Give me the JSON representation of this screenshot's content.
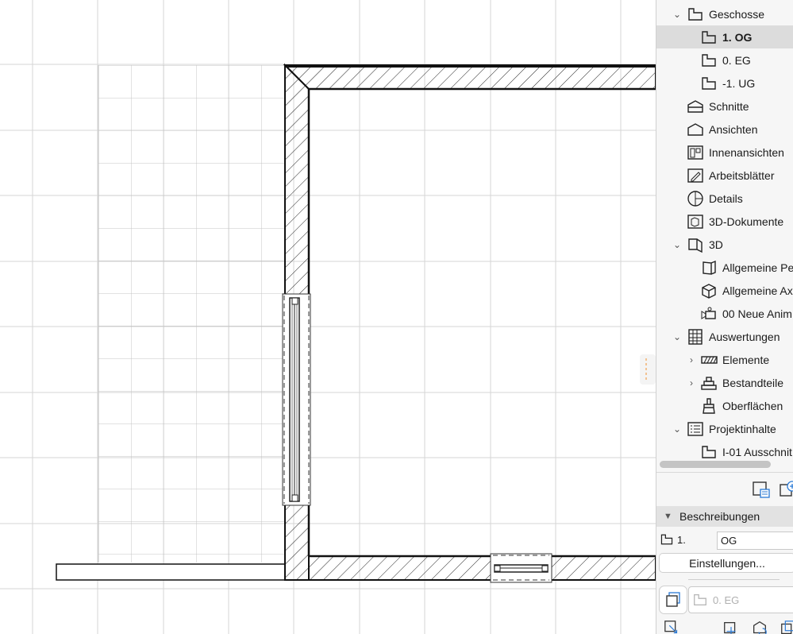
{
  "navigator": {
    "items": [
      {
        "label": "Geschosse",
        "icon": "floor-icon"
      },
      {
        "label": "1. OG",
        "icon": "floor-icon",
        "selected": true
      },
      {
        "label": "0. EG",
        "icon": "floor-icon"
      },
      {
        "label": "-1. UG",
        "icon": "floor-icon"
      },
      {
        "label": "Schnitte",
        "icon": "section-icon"
      },
      {
        "label": "Ansichten",
        "icon": "elevation-icon"
      },
      {
        "label": "Innenansichten",
        "icon": "interior-elevation-icon"
      },
      {
        "label": "Arbeitsblätter",
        "icon": "worksheet-icon"
      },
      {
        "label": "Details",
        "icon": "detail-icon"
      },
      {
        "label": "3D-Dokumente",
        "icon": "3d-document-icon"
      },
      {
        "label": "3D",
        "icon": "3d-icon"
      },
      {
        "label": "Allgemeine Pe",
        "icon": "perspective-icon"
      },
      {
        "label": "Allgemeine Ax",
        "icon": "axonometry-icon"
      },
      {
        "label": "00 Neue Anim",
        "icon": "camera-icon"
      },
      {
        "label": "Auswertungen",
        "icon": "schedule-icon"
      },
      {
        "label": "Elemente",
        "icon": "hatch-icon"
      },
      {
        "label": "Bestandteile",
        "icon": "components-icon"
      },
      {
        "label": "Oberflächen",
        "icon": "brush-icon"
      },
      {
        "label": "Projektinhalte",
        "icon": "project-index-icon"
      },
      {
        "label": "I-01 Ausschnit",
        "icon": "floor-icon"
      }
    ]
  },
  "properties": {
    "section_title": "Beschreibungen",
    "story_number": "1.",
    "story_name": "OG",
    "settings_button": "Einstellungen...",
    "reference_story": "0. EG"
  },
  "colors": {
    "panel_bg": "#f6f6f6",
    "selection": "#dcdcdc",
    "accent_orange": "#f0a050",
    "accent_blue": "#2a7ad6"
  }
}
